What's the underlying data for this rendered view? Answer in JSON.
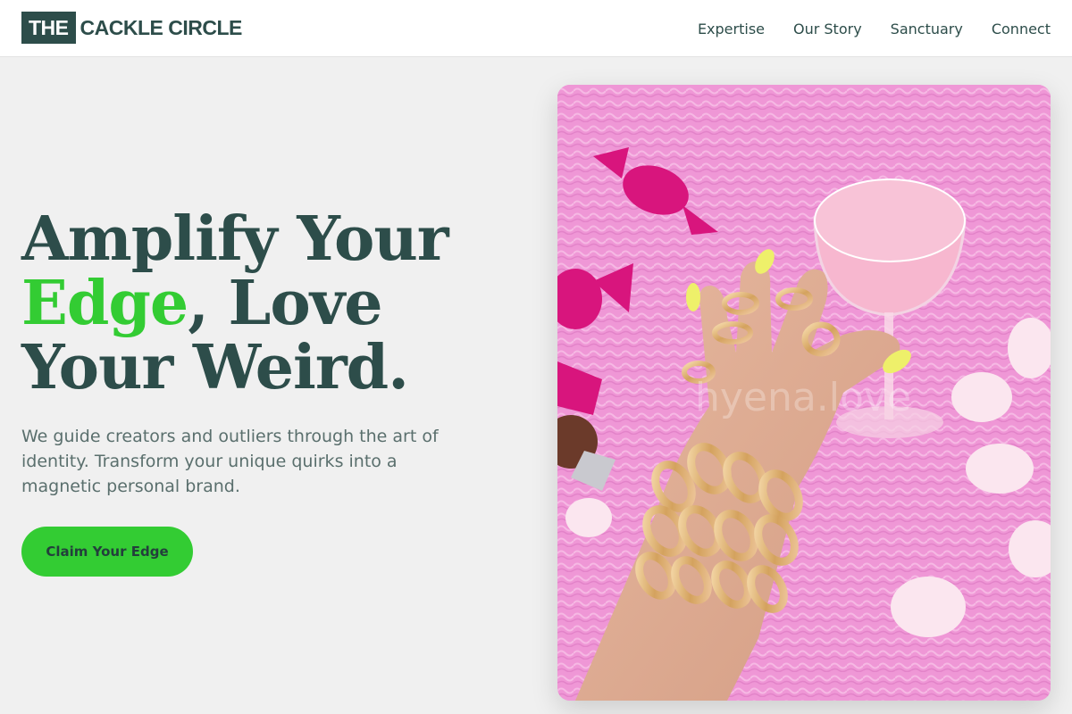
{
  "header": {
    "logo_box": "THE",
    "logo_rest": "CACKLE CIRCLE",
    "nav": [
      {
        "label": "Expertise"
      },
      {
        "label": "Our Story"
      },
      {
        "label": "Sanctuary"
      },
      {
        "label": "Connect"
      }
    ]
  },
  "hero": {
    "headline_part1": "Amplify Your",
    "headline_accent": "Edge",
    "headline_part2": ", Love Your Weird.",
    "subtext": "We guide creators and outliers through the art of identity. Transform your unique quirks into a magnetic personal brand.",
    "cta_label": "Claim Your Edge"
  },
  "image": {
    "watermark": "hyena.love",
    "description_icon": "photo-hand-with-gold-bracelets-and-pink-cocktail"
  },
  "colors": {
    "brand_dark": "#2d4d4a",
    "accent_green": "#33cc33",
    "background": "#f0f0f0",
    "fur_pink": "#ef97d6"
  }
}
